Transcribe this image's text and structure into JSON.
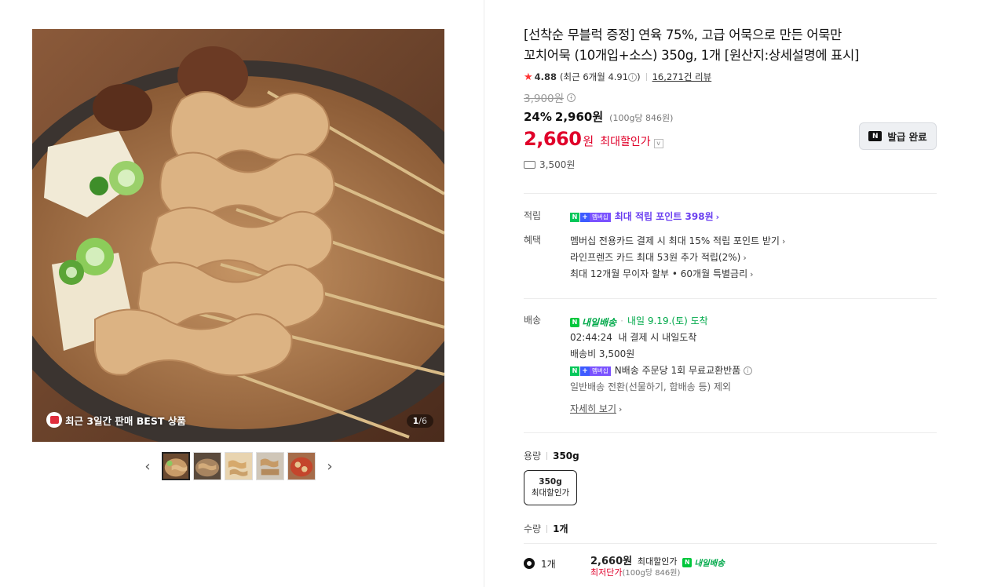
{
  "gallery": {
    "badge_text": "최근 3일간 판매 BEST 상품",
    "counter_current": "1",
    "counter_total": "/6",
    "thumbnails": [
      "oden-skewer-1",
      "oden-skewer-2",
      "oden-skewer-3",
      "oden-skewer-4",
      "oden-soup-5"
    ],
    "prev_icon": "chevron-left-icon",
    "next_icon": "chevron-right-icon"
  },
  "product": {
    "title_line1": "[선착순 무블럭 증정] 연육 75%, 고급 어묵으로 만든 어묵만",
    "title_line2": "꼬치어묵 (10개입+소스) 350g, 1개 [원산지:상세설명에 표시]",
    "rating": "4.88",
    "recent_rating": "(최근 6개월 4.91",
    "recent_rating_close": ")",
    "review_count": "16,271건 리뷰",
    "original_price": "3,900원",
    "discount_rate": "24%",
    "sale_price": "2,960원",
    "unit_price": "(100g당 846원)",
    "max_price": "2,660",
    "max_price_won": "원",
    "max_price_label": "최대할인가",
    "shipping_fee": "3,500원",
    "coupon_button": "발급 완료"
  },
  "benefits": {
    "points_label": "적립",
    "points_text": "최대 적립 포인트 398원",
    "benefit_label": "혜택",
    "benefit_lines": [
      "멤버십 전용카드 결제 시 최대 15% 적립 포인트 받기",
      "라인프렌즈 카드 최대 53원 추가 적립(2%)",
      "최대 12개월 무이자 할부 • 60개월 특별금리"
    ],
    "membership_badge": "멤버십"
  },
  "delivery": {
    "label": "배송",
    "nday_text": "내일배송",
    "arrival": "내일 9.19.(토) 도착",
    "countdown": "02:44:24",
    "countdown_suffix": "내 결제 시 내일도착",
    "fee": "배송비 3,500원",
    "exchange": "N배송 주문당 1회 무료교환반품",
    "exclusion": "일반배송 전환(선물하기, 합배송 등) 제외",
    "detail_link": "자세히 보기"
  },
  "options": {
    "capacity_label": "용량",
    "capacity_value": "350g",
    "option_box_line1": "350g",
    "option_box_line2": "최대할인가",
    "quantity_label": "수량",
    "quantity_value": "1개"
  },
  "selected": {
    "qty": "1개",
    "price": "2,660원",
    "price_label": "최대할인가",
    "nday_text": "내일배송",
    "lowest": "최저단가",
    "unit": "(100g당 846원)"
  },
  "colors": {
    "accent_red": "#e0002a",
    "naver_green": "#03c75a",
    "membership_purple": "#6a3ff0"
  }
}
